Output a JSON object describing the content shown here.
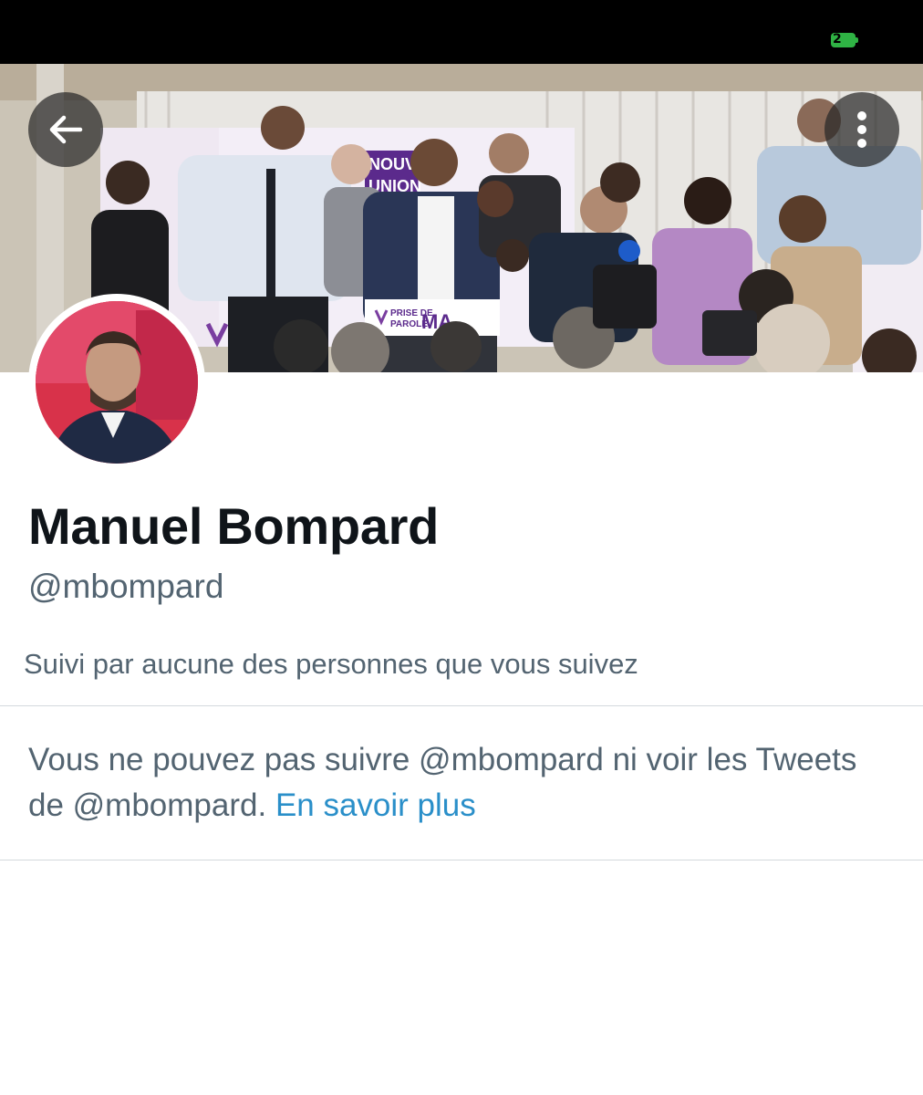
{
  "status_bar": {
    "battery_level": "2",
    "battery_color": "#2fb344"
  },
  "header": {
    "back_icon": "arrow-left-icon",
    "more_icon": "more-vertical-icon"
  },
  "banner": {
    "sign_text_1": "NOUVE",
    "sign_text_2": "UNION",
    "podium_text_1": "PRISE DE",
    "podium_text_2": "PAROLE",
    "podium_text_3": "MA"
  },
  "profile": {
    "display_name": "Manuel Bompard",
    "handle": "@mbompard",
    "followed_by": "Suivi par aucune des personnes que vous suivez"
  },
  "notice": {
    "text": "Vous ne pouvez pas suivre @mbompard ni voir les Tweets de @mbompard.",
    "link_label": "En savoir plus",
    "link_color": "#2a8fc9"
  },
  "colors": {
    "name": "#0f1419",
    "secondary": "#536471",
    "divider": "#d4d9dd",
    "avatar_background": "#d8324a"
  }
}
